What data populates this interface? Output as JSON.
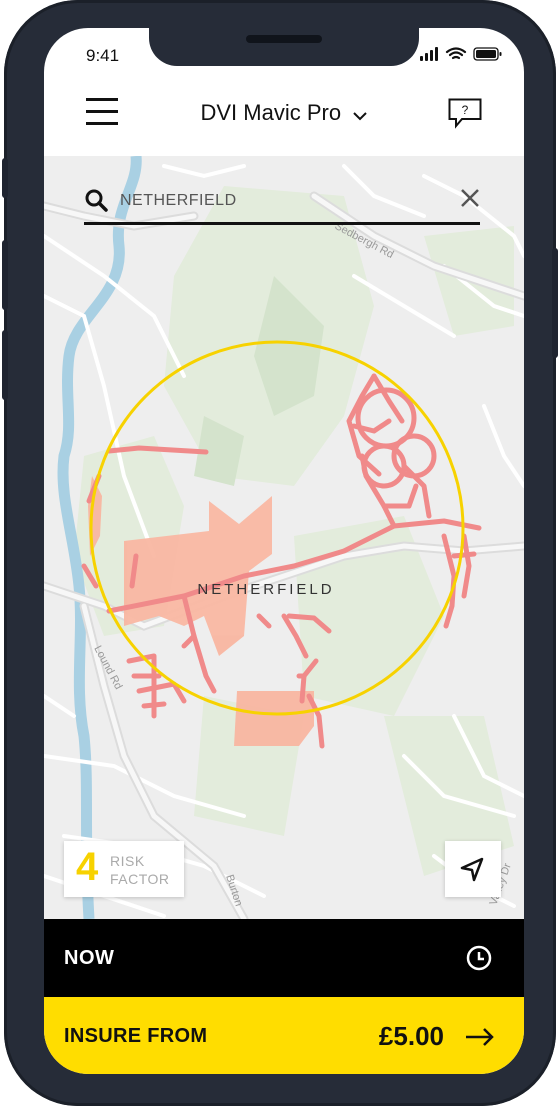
{
  "status_bar": {
    "time": "9:41"
  },
  "header": {
    "title": "DVI Mavic Pro",
    "help_icon_text": "?"
  },
  "search": {
    "value": "NETHERFIELD"
  },
  "map": {
    "place_label": "NETHERFIELD",
    "roads": [
      "Sedbergh Rd",
      "Lound Rd",
      "Burton",
      "Valley Dr"
    ],
    "zone_color": "#f7d200",
    "hazard_color": "#f08a8a",
    "area_color": "#f9b7a2"
  },
  "risk": {
    "number": "4",
    "label_line1": "RISK",
    "label_line2": "FACTOR"
  },
  "time_bar": {
    "label": "NOW"
  },
  "insure_bar": {
    "label": "INSURE FROM",
    "price": "£5.00"
  },
  "colors": {
    "accent": "#ffdd00",
    "frame": "#262c38"
  }
}
